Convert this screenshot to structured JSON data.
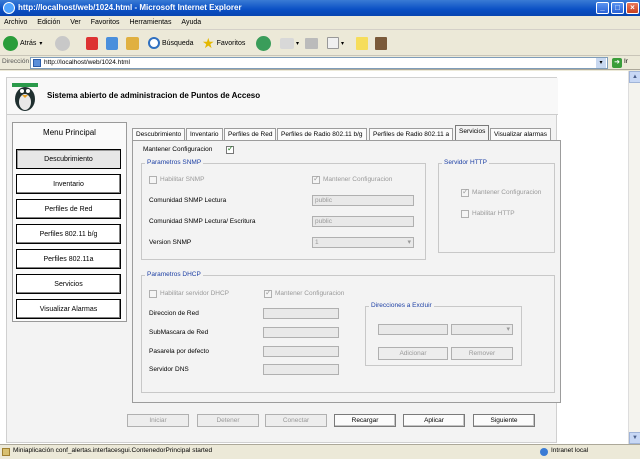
{
  "window": {
    "title": "http://localhost/web/1024.html - Microsoft Internet Explorer"
  },
  "menu": [
    "Archivo",
    "Edición",
    "Ver",
    "Favoritos",
    "Herramientas",
    "Ayuda"
  ],
  "toolbar": {
    "back": "Atrás",
    "search": "Búsqueda",
    "favorites": "Favoritos"
  },
  "address": {
    "label": "Dirección",
    "url": "http://localhost/web/1024.html",
    "go": "Ir"
  },
  "app": {
    "title": "Sistema abierto de administracion de Puntos de Acceso",
    "menu_title": "Menu Principal",
    "nav": [
      "Descubrimiento",
      "Inventario",
      "Perfiles de Red",
      "Perfiles 802.11 b/g",
      "Perfiles 802.11a",
      "Servicios",
      "Visualizar Alarmas"
    ],
    "tabs": [
      "Descubrimiento",
      "Inventario",
      "Perfiles de Red",
      "Perfiles de Radio 802.11 b/g",
      "Perfiles de Radio 802.11 a",
      "Servicios",
      "Visualizar alarmas"
    ],
    "active_tab": "Servicios",
    "mantener": "Mantener Configuracion",
    "snmp": {
      "legend": "Parametros SNMP",
      "habilitar": "Habilitar SNMP",
      "mantener": "Mantener Configuracion",
      "lectura_label": "Comunidad SNMP Lectura",
      "lectura_value": "public",
      "escritura_label": "Comunidad SNMP Lectura/ Escritura",
      "escritura_value": "public",
      "version_label": "Version SNMP",
      "version_value": "1"
    },
    "http": {
      "legend": "Servidor HTTP",
      "mantener": "Mantener Configuracion",
      "habilitar": "Habilitar HTTP"
    },
    "dhcp": {
      "legend": "Parametros DHCP",
      "habilitar": "Habilitar servidor DHCP",
      "mantener": "Mantener Configuracion",
      "red": "Direccion de Red",
      "mascara": "SubMascara de Red",
      "pasarela": "Pasarela por defecto",
      "dns": "Servidor DNS",
      "excluir_legend": "Direcciones a Excluir",
      "adicionar": "Adicionar",
      "remover": "Remover"
    },
    "buttons": [
      "Iniciar",
      "Detener",
      "Conectar",
      "Recargar",
      "Aplicar",
      "Siguiente"
    ]
  },
  "status": {
    "text": "Miniaplicación conf_alertas.interfacesgui.ContenedorPrincipal started",
    "zone": "Intranet local"
  }
}
